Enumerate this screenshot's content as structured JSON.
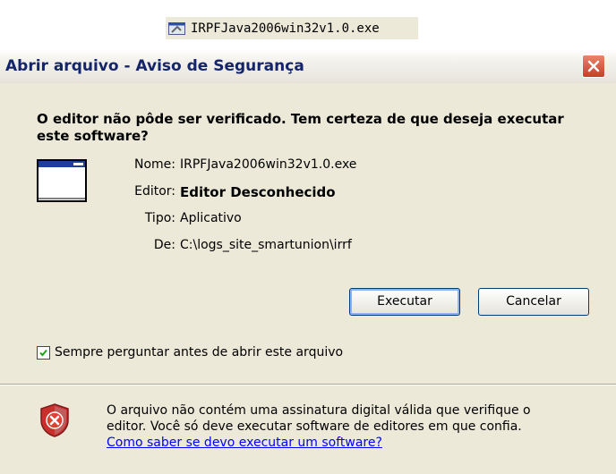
{
  "taskbar_file": {
    "name": "IRPFJava2006win32v1.0.exe",
    "icon": "installer-icon"
  },
  "dialog": {
    "title": "Abrir arquivo - Aviso de Segurança",
    "close_icon": "close-icon",
    "headline": "O editor não pôde ser verificado.  Tem certeza de que deseja executar este software?",
    "app_icon": "application-window-icon",
    "info": [
      {
        "label": "Nome:",
        "value": "IRPFJava2006win32v1.0.exe"
      },
      {
        "label": "Editor:",
        "value": "Editor Desconhecido"
      },
      {
        "label": "Tipo:",
        "value": "Aplicativo"
      },
      {
        "label": "De:",
        "value": "C:\\logs_site_smartunion\\irrf"
      }
    ],
    "run_button": "Executar",
    "cancel_button": "Cancelar",
    "always_ask": {
      "label": "Sempre perguntar antes de abrir este arquivo",
      "checked": true
    },
    "warning": {
      "icon": "security-shield-icon",
      "line1": "O arquivo não contém uma assinatura digital válida que verifique o",
      "line2": "editor.  Você só deve executar software de editores em que confia.",
      "link": "Como saber se devo executar um software?"
    },
    "colors": {
      "title_text": "#15256b",
      "link": "#0000ff",
      "dialog_bg": "#ece9d8",
      "close": "#c5402a"
    }
  }
}
